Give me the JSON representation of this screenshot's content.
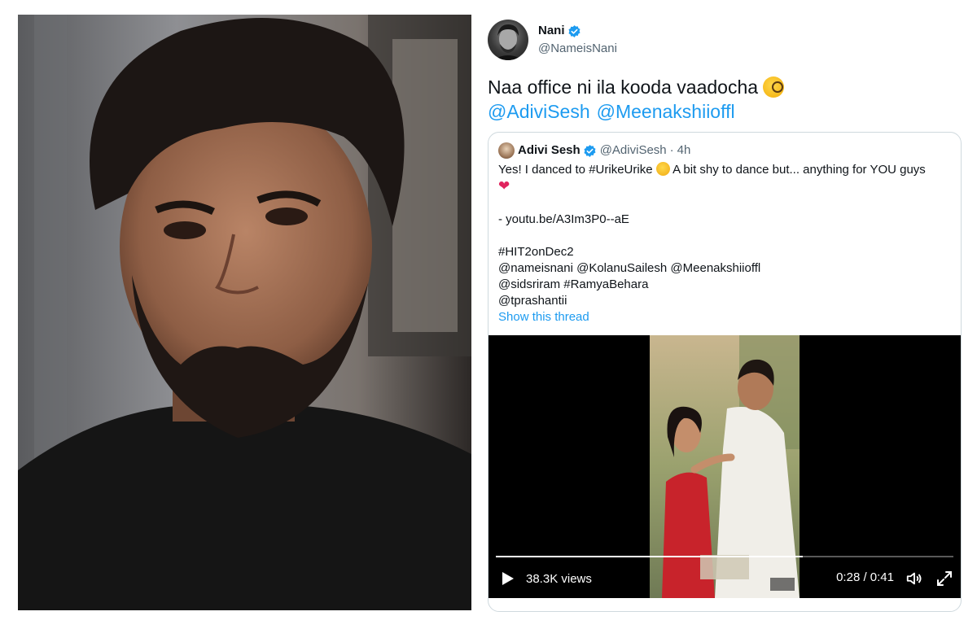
{
  "tweet": {
    "author_name": "Nani",
    "author_handle": "@NameisNani",
    "text": "Naa office ni ila kooda vaadocha",
    "mentions": [
      "@AdiviSesh",
      "@Meenakshiioffl"
    ],
    "verified_color": "#1d9bf0",
    "emoji": "monocle-face-icon"
  },
  "quote": {
    "name": "Adivi Sesh",
    "handle": "@AdiviSesh",
    "separator": "·",
    "time": "4h",
    "line1_a": "Yes! I danced to #UrikeUrike",
    "line1_b": "A bit shy to dance but... anything for YOU guys",
    "heart": "❤",
    "link_line": "- youtu.be/A3Im3P0--aE",
    "hashtag_line": "#HIT2onDec2",
    "mentions_line1": "@nameisnani @KolanuSailesh @Meenakshiioffl",
    "mentions_line2": "@sidsriram #RamyaBehara",
    "mentions_line3": "@tprashantii",
    "show_thread": "Show this thread"
  },
  "video": {
    "views": "38.3K views",
    "time": "0:28 / 0:41",
    "progress": 0.67
  }
}
